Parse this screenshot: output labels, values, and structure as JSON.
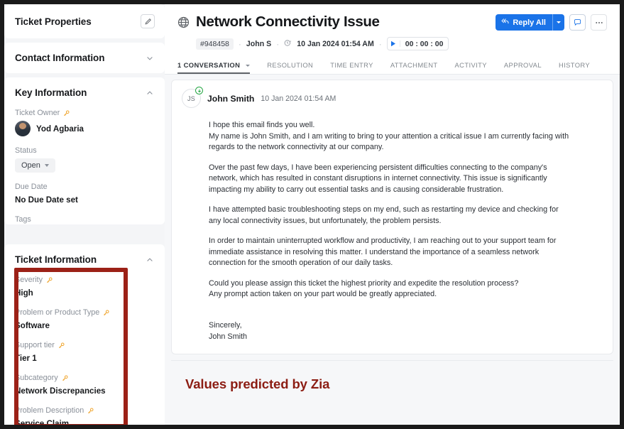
{
  "sidebar": {
    "properties_panel": {
      "title": "Ticket Properties",
      "edit_icon": "pencil-icon"
    },
    "contact_information": {
      "title": "Contact Information",
      "chevron": "chevron-down-icon"
    },
    "key_information": {
      "title": "Key Information",
      "chevron": "chevron-up-icon",
      "fields": [
        {
          "label": "Ticket Owner",
          "value": "Yod Agbaria",
          "zia": true,
          "type": "owner"
        },
        {
          "label": "Status",
          "value": "Open",
          "zia": false,
          "type": "dropdown"
        },
        {
          "label": "Due Date",
          "value": "No Due Date set",
          "zia": false,
          "type": "text"
        },
        {
          "label": "Tags",
          "value": "",
          "zia": false,
          "type": "text"
        }
      ]
    },
    "ticket_information": {
      "title": "Ticket Information",
      "chevron": "chevron-up-icon",
      "fields": [
        {
          "label": "Severity",
          "value": "High",
          "zia": true
        },
        {
          "label": "Problem or Product Type",
          "value": "Software",
          "zia": true
        },
        {
          "label": "Support tier",
          "value": "Tier 1",
          "zia": true
        },
        {
          "label": "Subcategory",
          "value": "Network Discrepancies",
          "zia": true
        },
        {
          "label": "Problem Description",
          "value": "Service Claim",
          "zia": true
        }
      ]
    },
    "highlight": {
      "color": "#9c2117"
    }
  },
  "header": {
    "channel_icon": "globe-icon",
    "title": "Network Connectivity Issue",
    "meta": {
      "ticket_id": "#948458",
      "contact": "John S",
      "clock_icon": "clock-icon",
      "date": "10 Jan 2024 01:54 AM",
      "timer_play_icon": "play-icon",
      "timer": "00 : 00 : 00"
    },
    "actions": {
      "reply_all_label": "Reply All",
      "reply_all_icon": "reply-all-icon",
      "reply_all_caret": "chevron-down-icon",
      "chat_icon": "chat-bubble-icon",
      "more_icon": "more-horizontal-icon",
      "accent": "#1a73e8"
    },
    "tabs": [
      {
        "label": "1 CONVERSATION",
        "active": true,
        "caret": true
      },
      {
        "label": "RESOLUTION",
        "active": false,
        "caret": false
      },
      {
        "label": "TIME ENTRY",
        "active": false,
        "caret": false
      },
      {
        "label": "ATTACHMENT",
        "active": false,
        "caret": false
      },
      {
        "label": "ACTIVITY",
        "active": false,
        "caret": false
      },
      {
        "label": "APPROVAL",
        "active": false,
        "caret": false
      },
      {
        "label": "HISTORY",
        "active": false,
        "caret": false
      }
    ]
  },
  "conversation": {
    "avatar_initials": "JS",
    "badge_icon": "download-arrow-icon",
    "sender": "John Smith",
    "timestamp": "10 Jan 2024 01:54 AM",
    "paragraphs": [
      "I hope this email finds you well.\nMy name is John Smith, and I am writing to bring to your attention a critical issue I am currently facing with regards to the network connectivity at our company.",
      "Over the past few days, I have been experiencing persistent difficulties connecting to the company's network, which has resulted in constant disruptions in internet connectivity. This issue is significantly impacting my ability to carry out essential tasks and is causing considerable frustration.",
      "I have attempted basic troubleshooting steps on my end, such as restarting my device and checking for any local connectivity issues, but unfortunately, the problem persists.",
      "In order to maintain uninterrupted workflow and productivity, I am reaching out to your support team for immediate assistance in resolving this matter. I understand the importance of a seamless network connection for the smooth operation of our daily tasks.",
      "Could you please assign this ticket the highest priority and expedite the resolution process?\nAny prompt action taken on your part would be greatly appreciated.",
      "\nSincerely,\nJohn Smith"
    ]
  },
  "annotation": {
    "text": "Values predicted by Zia",
    "color": "#8c1d13"
  }
}
